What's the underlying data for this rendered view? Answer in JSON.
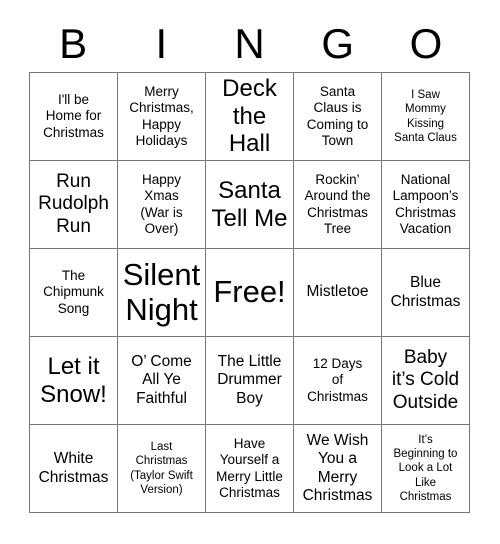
{
  "header": {
    "letters": [
      "B",
      "I",
      "N",
      "G",
      "O"
    ]
  },
  "grid": {
    "rows": 5,
    "columns": 5,
    "border_color": "#777777",
    "background": "#ffffff",
    "text_color": "#000000",
    "cells": [
      {
        "text": "I'll be\nHome for\nChristmas",
        "size": "fs-s"
      },
      {
        "text": "Merry\nChristmas,\nHappy\nHolidays",
        "size": "fs-s"
      },
      {
        "text": "Deck\nthe\nHall",
        "size": "fs-xl"
      },
      {
        "text": "Santa\nClaus is\nComing to\nTown",
        "size": "fs-s"
      },
      {
        "text": "I Saw\nMommy\nKissing\nSanta Claus",
        "size": "fs-xs"
      },
      {
        "text": "Run\nRudolph\nRun",
        "size": "fs-l"
      },
      {
        "text": "Happy\nXmas\n(War is\nOver)",
        "size": "fs-s"
      },
      {
        "text": "Santa\nTell Me",
        "size": "fs-xl"
      },
      {
        "text": "Rockin’\nAround the\nChristmas\nTree",
        "size": "fs-s"
      },
      {
        "text": "National\nLampoon’s\nChristmas\nVacation",
        "size": "fs-s"
      },
      {
        "text": "The\nChipmunk\nSong",
        "size": "fs-s"
      },
      {
        "text": "Silent\nNight",
        "size": "fs-xxl"
      },
      {
        "text": "Free!",
        "size": "fs-xxl"
      },
      {
        "text": "Mistletoe",
        "size": "fs-m"
      },
      {
        "text": "Blue\nChristmas",
        "size": "fs-m"
      },
      {
        "text": "Let it\nSnow!",
        "size": "fs-xl"
      },
      {
        "text": "O’ Come\nAll Ye\nFaithful",
        "size": "fs-m"
      },
      {
        "text": "The Little\nDrummer\nBoy",
        "size": "fs-m"
      },
      {
        "text": "12 Days\nof\nChristmas",
        "size": "fs-s"
      },
      {
        "text": "Baby\nit’s Cold\nOutside",
        "size": "fs-l"
      },
      {
        "text": "White\nChristmas",
        "size": "fs-m"
      },
      {
        "text": "Last\nChristmas\n(Taylor Swift\nVersion)",
        "size": "fs-xs"
      },
      {
        "text": "Have\nYourself a\nMerry Little\nChristmas",
        "size": "fs-s"
      },
      {
        "text": "We Wish\nYou a\nMerry\nChristmas",
        "size": "fs-m"
      },
      {
        "text": "It’s\nBeginning to\nLook a Lot\nLike\nChristmas",
        "size": "fs-xs"
      }
    ]
  }
}
